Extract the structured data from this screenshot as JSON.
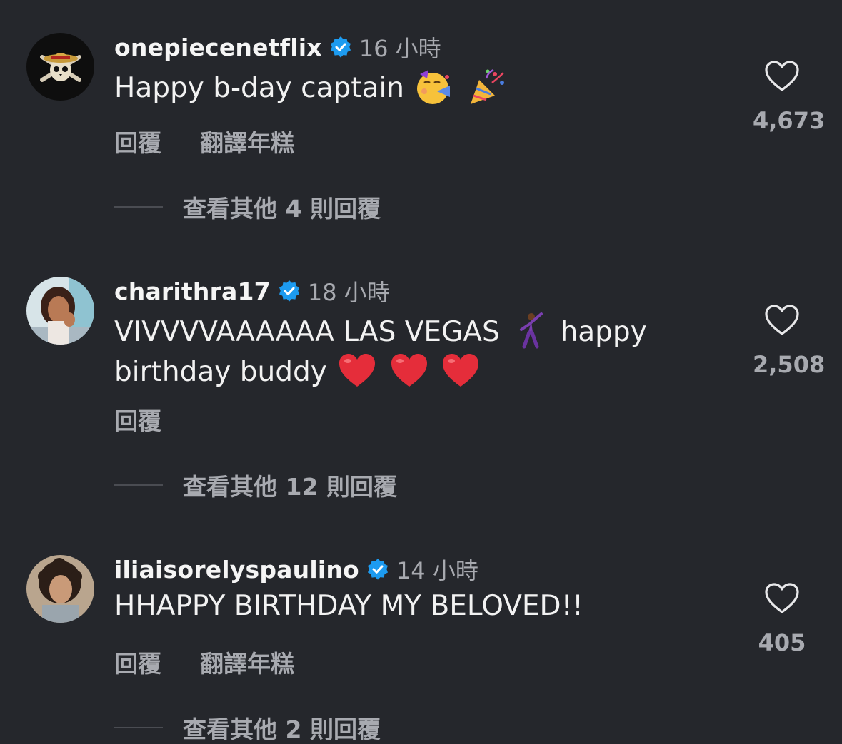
{
  "comments": [
    {
      "username": "onepiecenetflix",
      "time": "16 小時",
      "text": "Happy b-day captain",
      "emojis": [
        "face-with-party-horn",
        "party-popper"
      ],
      "actions": {
        "reply": "回覆",
        "translate": "翻譯年糕"
      },
      "likes": "4,673",
      "view_replies": "查看其他 4 則回覆"
    },
    {
      "username": "charithra17",
      "time": "18 小時",
      "text_line1": "VIVVVVAAAAAA LAS VEGAS",
      "text_line1b": "happy",
      "text_line2": "birthday buddy",
      "emojis": [
        "man-dancing",
        "red-heart",
        "red-heart",
        "red-heart"
      ],
      "actions": {
        "reply": "回覆"
      },
      "likes": "2,508",
      "view_replies": "查看其他 12 則回覆"
    },
    {
      "username": "iliaisorelyspaulino",
      "time": "14 小時",
      "text": "HHAPPY BIRTHDAY MY BELOVED!!",
      "actions": {
        "reply": "回覆",
        "translate": "翻譯年糕"
      },
      "likes": "405",
      "view_replies": "查看其他 2 則回覆"
    }
  ],
  "colors": {
    "background": "#25272c",
    "verified": "#1d9bf0",
    "secondary_text": "#a8aab0",
    "heart": "#e52d3a"
  }
}
